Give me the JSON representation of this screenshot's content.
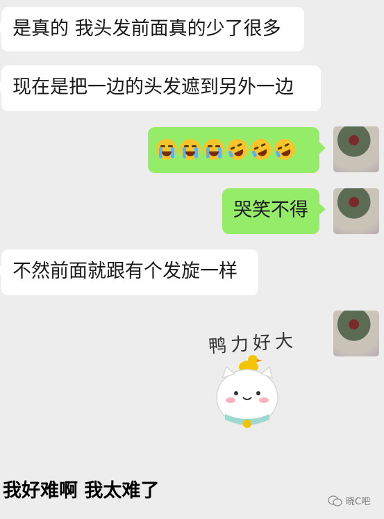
{
  "messages": [
    {
      "text": "是真的 我头发前面真的少了很多"
    },
    {
      "text": "现在是把一边的头发遮到另外一边"
    },
    {
      "emoji": [
        "loudly-crying-face-icon",
        "loudly-crying-face-icon",
        "loudly-crying-face-icon",
        "rolling-laughing-face-icon",
        "rolling-laughing-face-icon",
        "rolling-laughing-face-icon"
      ]
    },
    {
      "text": "哭笑不得"
    },
    {
      "text": "不然前面就跟有个发旋一样"
    },
    {
      "sticker_text": "鸭力好大"
    }
  ],
  "caption": "我好难啊  我太难了",
  "watermark": "晓C吧",
  "colors": {
    "background": "#ededed",
    "incoming": "#ffffff",
    "outgoing": "#95ec69"
  }
}
